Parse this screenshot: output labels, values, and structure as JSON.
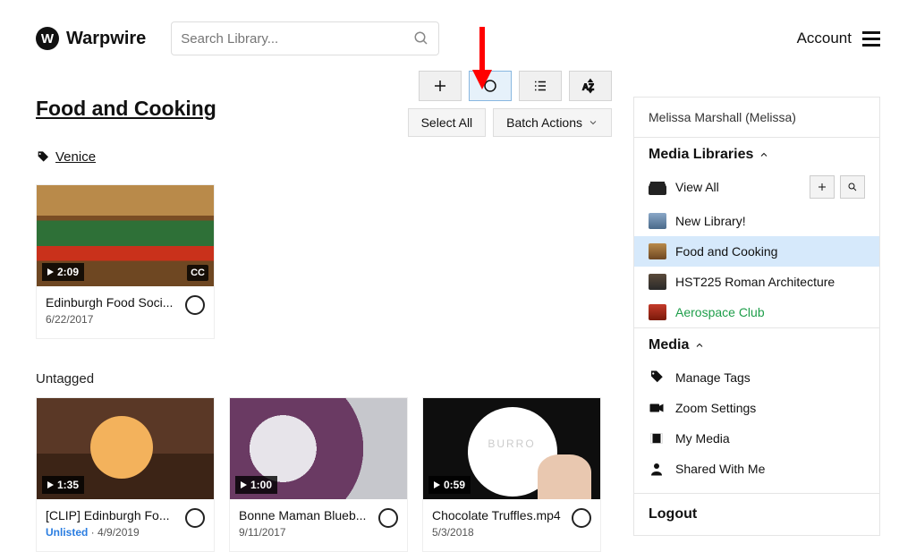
{
  "header": {
    "brand": "Warpwire",
    "search_placeholder": "Search Library...",
    "account_label": "Account"
  },
  "page": {
    "title": "Food and Cooking",
    "tag_label": "Venice",
    "untagged_label": "Untagged"
  },
  "toolbar": {
    "select_all": "Select All",
    "batch_actions": "Batch Actions"
  },
  "cards": {
    "venice": [
      {
        "title": "Edinburgh Food Soci...",
        "date": "6/22/2017",
        "duration": "2:09",
        "cc": "CC"
      }
    ],
    "untagged": [
      {
        "title": "[CLIP] Edinburgh Fo...",
        "date": "4/9/2019",
        "duration": "1:35",
        "unlisted": "Unlisted"
      },
      {
        "title": "Bonne Maman Blueb...",
        "date": "9/11/2017",
        "duration": "1:00"
      },
      {
        "title": "Chocolate Truffles.mp4",
        "date": "5/3/2018",
        "duration": "0:59"
      }
    ]
  },
  "sidebar": {
    "user": "Melissa Marshall (Melissa)",
    "libraries_header": "Media Libraries",
    "libraries": [
      {
        "name": "View All"
      },
      {
        "name": "New Library!"
      },
      {
        "name": "Food and Cooking"
      },
      {
        "name": "HST225 Roman Architecture"
      },
      {
        "name": "Aerospace Club"
      }
    ],
    "media_header": "Media",
    "media": [
      {
        "name": "Manage Tags"
      },
      {
        "name": "Zoom Settings"
      },
      {
        "name": "My Media"
      },
      {
        "name": "Shared With Me"
      }
    ],
    "logout": "Logout"
  }
}
